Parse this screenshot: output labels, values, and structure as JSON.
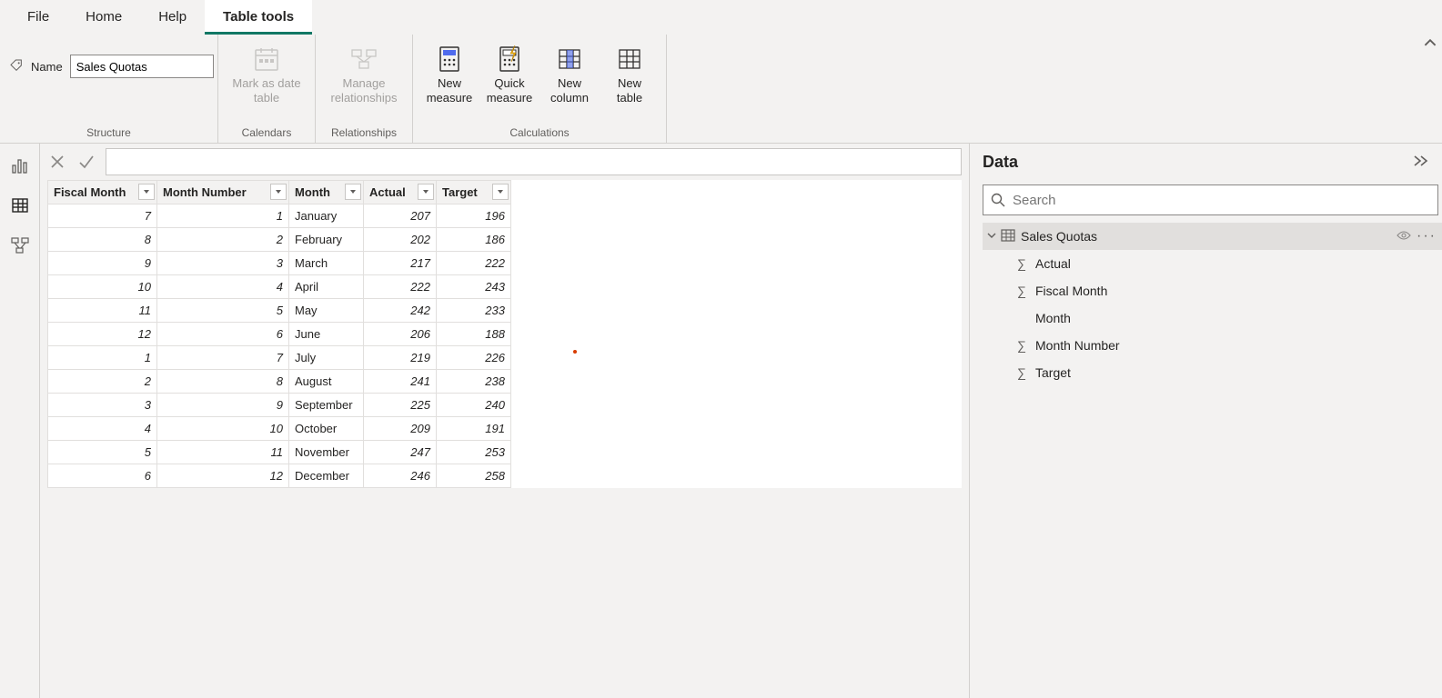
{
  "tabs": {
    "file": "File",
    "home": "Home",
    "help": "Help",
    "tabletools": "Table tools"
  },
  "ribbon": {
    "name_label": "Name",
    "name_value": "Sales Quotas",
    "structure_group": "Structure",
    "calendars": {
      "label": "Mark as date\ntable",
      "group": "Calendars"
    },
    "relationships": {
      "label": "Manage\nrelationships",
      "group": "Relationships"
    },
    "calculations": {
      "group": "Calculations",
      "new_measure": "New\nmeasure",
      "quick_measure": "Quick\nmeasure",
      "new_column": "New\ncolumn",
      "new_table": "New\ntable"
    }
  },
  "columns": [
    "Fiscal Month",
    "Month Number",
    "Month",
    "Actual",
    "Target"
  ],
  "rows": [
    {
      "fm": 7,
      "mn": 1,
      "m": "January",
      "a": 207,
      "t": 196
    },
    {
      "fm": 8,
      "mn": 2,
      "m": "February",
      "a": 202,
      "t": 186
    },
    {
      "fm": 9,
      "mn": 3,
      "m": "March",
      "a": 217,
      "t": 222
    },
    {
      "fm": 10,
      "mn": 4,
      "m": "April",
      "a": 222,
      "t": 243
    },
    {
      "fm": 11,
      "mn": 5,
      "m": "May",
      "a": 242,
      "t": 233
    },
    {
      "fm": 12,
      "mn": 6,
      "m": "June",
      "a": 206,
      "t": 188
    },
    {
      "fm": 1,
      "mn": 7,
      "m": "July",
      "a": 219,
      "t": 226
    },
    {
      "fm": 2,
      "mn": 8,
      "m": "August",
      "a": 241,
      "t": 238
    },
    {
      "fm": 3,
      "mn": 9,
      "m": "September",
      "a": 225,
      "t": 240
    },
    {
      "fm": 4,
      "mn": 10,
      "m": "October",
      "a": 209,
      "t": 191
    },
    {
      "fm": 5,
      "mn": 11,
      "m": "November",
      "a": 247,
      "t": 253
    },
    {
      "fm": 6,
      "mn": 12,
      "m": "December",
      "a": 246,
      "t": 258
    }
  ],
  "right": {
    "title": "Data",
    "search_placeholder": "Search",
    "table": "Sales Quotas",
    "fields": [
      {
        "name": "Actual",
        "sigma": true
      },
      {
        "name": "Fiscal Month",
        "sigma": true
      },
      {
        "name": "Month",
        "sigma": false
      },
      {
        "name": "Month Number",
        "sigma": true
      },
      {
        "name": "Target",
        "sigma": true
      }
    ]
  }
}
